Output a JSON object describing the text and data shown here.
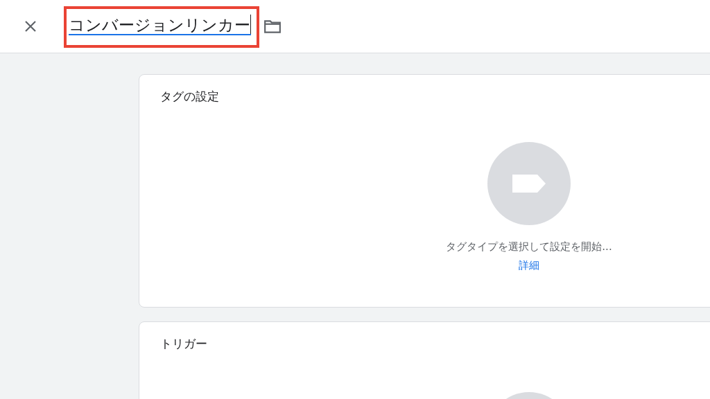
{
  "header": {
    "title_field": {
      "value": "コンバージョンリンカー",
      "highlighted": true
    }
  },
  "cards": [
    {
      "title": "タグの設定",
      "hint": "タグタイプを選択して設定を開始...",
      "link": "詳細"
    },
    {
      "title": "トリガー"
    }
  ]
}
